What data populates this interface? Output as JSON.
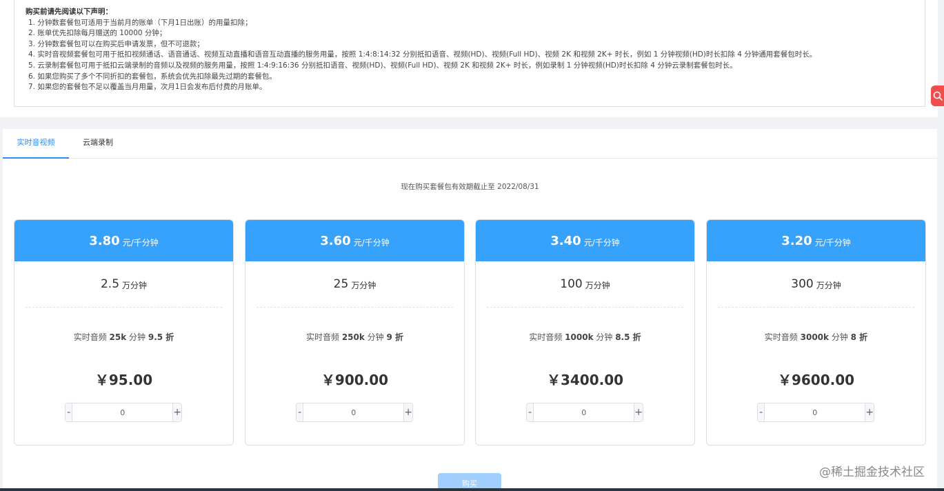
{
  "notice": {
    "title": "购买前请先阅读以下声明：",
    "lines": [
      "1. 分钟数套餐包可适用于当前月的账单（下月1日出账）的用量扣除；",
      "2. 账单优先扣除每月赠送的 10000 分钟；",
      "3. 分钟数套餐包可以在购买后申请发票，但不可退款；",
      "4. 实时音视频套餐包可用于抵扣视频通话、语音通话、视频互动直播和语音互动直播的服务用量，按照 1:4:8:14:32 分别抵扣语音、视频(HD)、视频(Full HD)、视频 2K 和视频 2K+ 时长，例如 1 分钟视频(HD)时长扣除 4 分钟通用套餐包时长。",
      "5. 云录制套餐包可用于抵扣云端录制的音频以及视频的服务用量，按照 1:4:9:16:36 分别抵扣语音、视频(HD)、视频(Full HD)、视频 2K 和视频 2K+ 时长，例如录制 1 分钟视频(HD)时长扣除 4 分钟云录制套餐包时长。",
      "6. 如果您购买了多个不同折扣的套餐包，系统会优先扣除最先过期的套餐包。",
      "7. 如果您的套餐包不足以覆盖当月用量，次月1日会发布后付费的月账单。"
    ]
  },
  "tabs": [
    {
      "label": "实时音视频",
      "active": true
    },
    {
      "label": "云端录制",
      "active": false
    }
  ],
  "expiry_text": "现在购买套餐包有效期截止至 2022/08/31",
  "price_unit": "元/千分钟",
  "amount_unit": "万分钟",
  "packages": [
    {
      "price": "3.80",
      "amount": "2.5",
      "desc_prefix": "实时音频 ",
      "desc_bold": "25k",
      "desc_mid": " 分钟 ",
      "desc_discount": "9.5 折",
      "total": "￥95.00",
      "qty": "0"
    },
    {
      "price": "3.60",
      "amount": "25",
      "desc_prefix": "实时音频 ",
      "desc_bold": "250k",
      "desc_mid": " 分钟 ",
      "desc_discount": "9 折",
      "total": "￥900.00",
      "qty": "0"
    },
    {
      "price": "3.40",
      "amount": "100",
      "desc_prefix": "实时音频 ",
      "desc_bold": "1000k",
      "desc_mid": " 分钟 ",
      "desc_discount": "8.5 折",
      "total": "￥3400.00",
      "qty": "0"
    },
    {
      "price": "3.20",
      "amount": "300",
      "desc_prefix": "实时音频 ",
      "desc_bold": "3000k",
      "desc_mid": " 分钟 ",
      "desc_discount": "8 折",
      "total": "￥9600.00",
      "qty": "0"
    }
  ],
  "stepper": {
    "minus": "-",
    "plus": "+"
  },
  "buy_label": "购买",
  "watermark": "@稀土掘金技术社区",
  "icons": {
    "side": "search-icon"
  },
  "colors": {
    "accent": "#36a2fb",
    "tab_active": "#2d8cf0",
    "buy_disabled": "#a0cffd",
    "side_button": "#f24d4d"
  }
}
